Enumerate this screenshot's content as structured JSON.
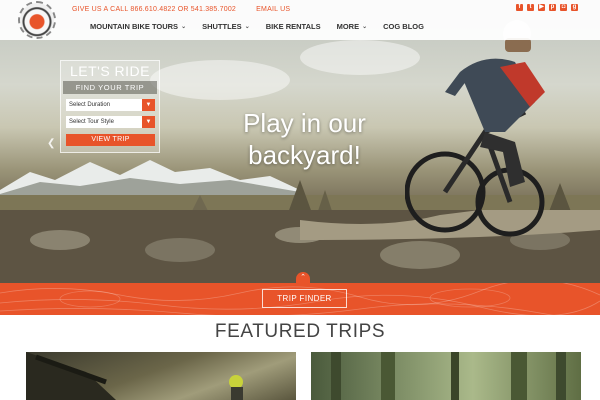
{
  "header": {
    "contact": {
      "phone_text": "GIVE US A CALL 866.610.4822 OR 541.385.7002",
      "email_text": "EMAIL US"
    },
    "social_icons": [
      {
        "name": "facebook-icon",
        "glyph": "f"
      },
      {
        "name": "twitter-icon",
        "glyph": "t"
      },
      {
        "name": "youtube-icon",
        "glyph": "▶"
      },
      {
        "name": "pinterest-icon",
        "glyph": "p"
      },
      {
        "name": "instagram-icon",
        "glyph": "◘"
      },
      {
        "name": "googleplus-icon",
        "glyph": "g"
      }
    ],
    "nav": [
      {
        "label": "MOUNTAIN BIKE TOURS",
        "has_dropdown": true
      },
      {
        "label": "SHUTTLES",
        "has_dropdown": true
      },
      {
        "label": "BIKE RENTALS",
        "has_dropdown": false
      },
      {
        "label": "MORE",
        "has_dropdown": true
      },
      {
        "label": "COG BLOG",
        "has_dropdown": false
      }
    ]
  },
  "find_trip": {
    "title": "LET'S RIDE",
    "subtitle": "FIND YOUR TRIP",
    "duration_placeholder": "Select Duration",
    "tour_style_placeholder": "Select Tour Style",
    "view_button": "VIEW TRIP"
  },
  "hero": {
    "tagline": "Play in our backyard!"
  },
  "finder": {
    "button": "TRIP FINDER"
  },
  "featured": {
    "title": "FEATURED TRIPS"
  },
  "colors": {
    "accent": "#e8542a",
    "heading": "#444444"
  }
}
